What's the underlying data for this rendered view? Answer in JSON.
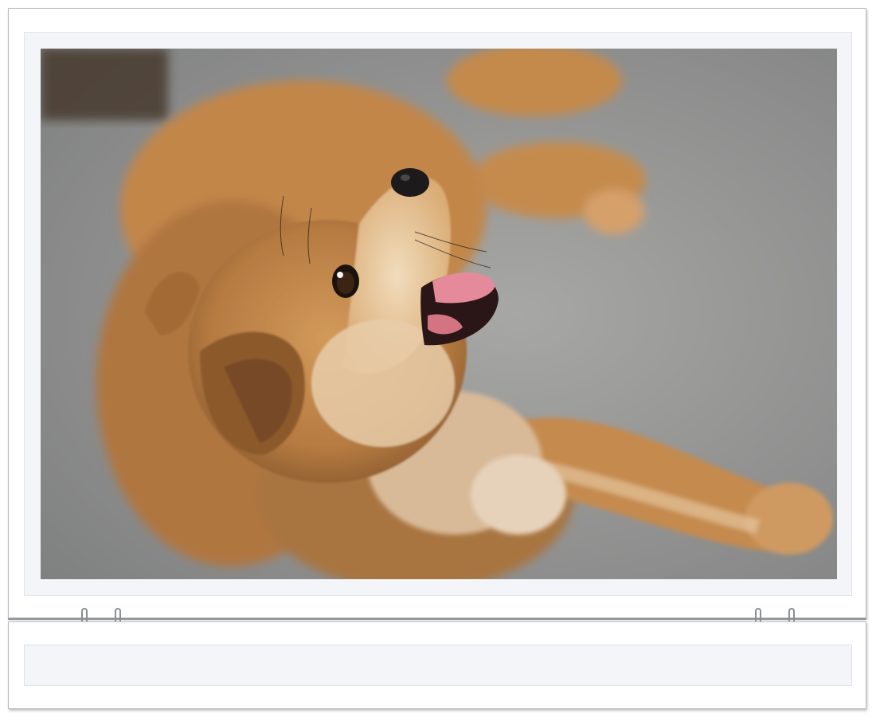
{
  "photo": {
    "subject": "puppy-lying-on-concrete",
    "colors": {
      "fur": "#c48a4c",
      "fur_light": "#e2c39a",
      "fur_dark": "#8a5a2e",
      "ground": "#9a9a98",
      "tongue": "#e58a9a",
      "nose": "#1c1a1a"
    }
  },
  "calendar": {
    "sheet_color": "#ffffff",
    "panel_color": "#f3f5f8",
    "binding_color": "#8d9095"
  },
  "binding_rings": [
    "ring-icon",
    "ring-icon",
    "ring-icon",
    "ring-icon"
  ]
}
